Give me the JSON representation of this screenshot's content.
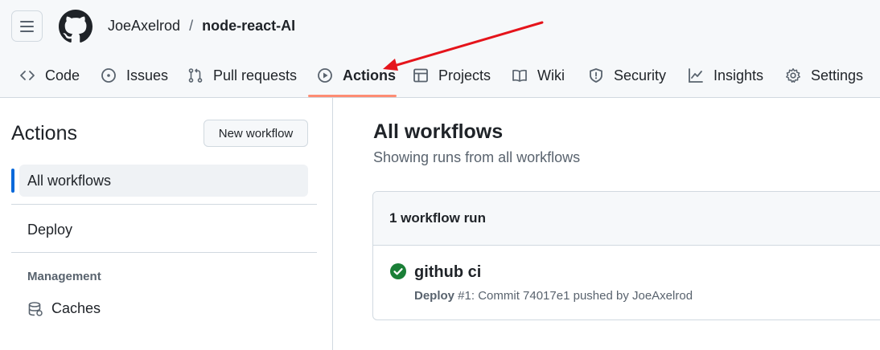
{
  "header": {
    "owner": "JoeAxelrod",
    "separator": "/",
    "repo": "node-react-AI"
  },
  "nav": {
    "code": "Code",
    "issues": "Issues",
    "pulls": "Pull requests",
    "actions": "Actions",
    "projects": "Projects",
    "wiki": "Wiki",
    "security": "Security",
    "insights": "Insights",
    "settings": "Settings",
    "selected": "Actions"
  },
  "sidebar": {
    "title": "Actions",
    "new_workflow": "New workflow",
    "items": [
      {
        "label": "All workflows",
        "active": true
      },
      {
        "label": "Deploy",
        "active": false
      }
    ],
    "section": "Management",
    "caches": "Caches"
  },
  "main": {
    "title": "All workflows",
    "subtitle": "Showing runs from all workflows",
    "runs_count": "1 workflow run",
    "runs": [
      {
        "name": "github ci",
        "workflow": "Deploy",
        "detail": " #1: Commit 74017e1 pushed by JoeAxelrod",
        "status": "success"
      }
    ]
  },
  "colors": {
    "accent_blue": "#0969da",
    "underline": "#fd8c73",
    "success": "#1a7f37",
    "annotation_arrow": "#e5141b"
  }
}
